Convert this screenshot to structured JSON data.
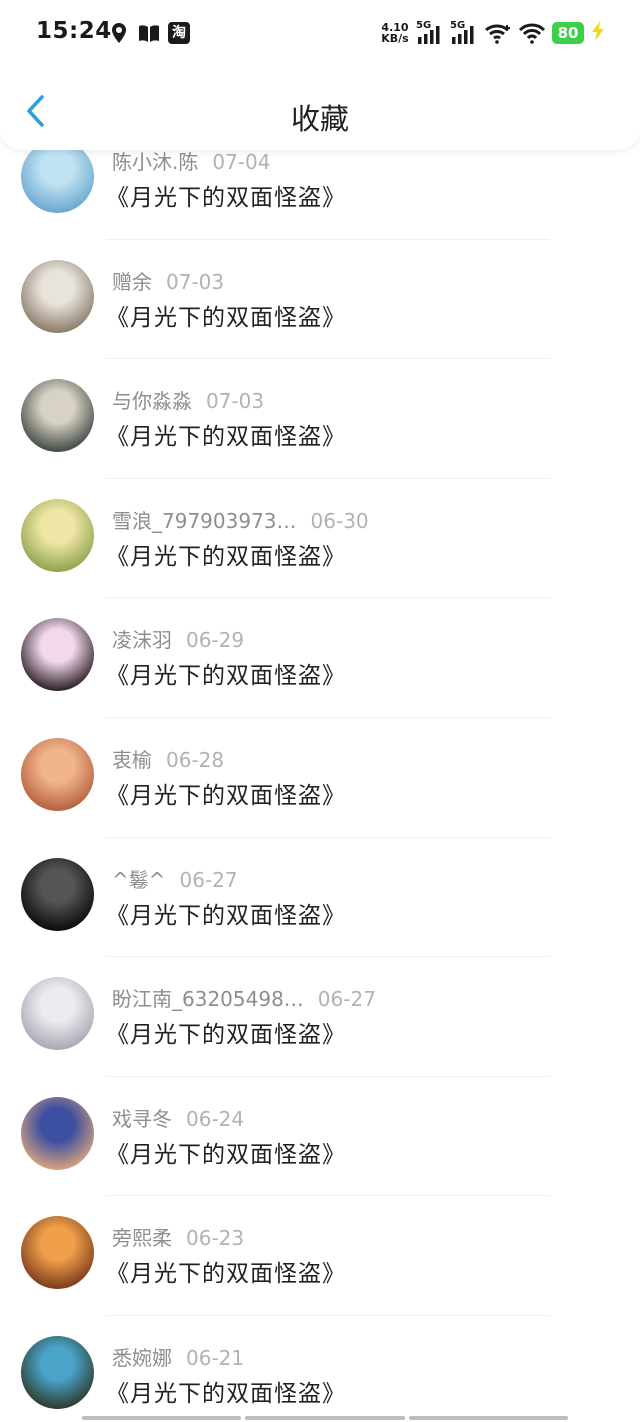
{
  "status_bar": {
    "time": "15:24",
    "net_speed_value": "4.10",
    "net_speed_unit": "KB/s",
    "sim1_label": "5G",
    "sim2_label": "5G",
    "battery": "80",
    "taobao_glyph": "淘"
  },
  "header": {
    "title": "收藏",
    "accent_color": "#2f9ee0"
  },
  "favorites": [
    {
      "user": "陈小沐.陈",
      "date": "07-04",
      "book": "《月光下的双面怪盗》",
      "avatar_colors": [
        "#bfe3f2",
        "#6aa6cf"
      ]
    },
    {
      "user": "赠余",
      "date": "07-03",
      "book": "《月光下的双面怪盗》",
      "avatar_colors": [
        "#e8e4dc",
        "#8b7a68"
      ]
    },
    {
      "user": "与你淼淼",
      "date": "07-03",
      "book": "《月光下的双面怪盗》",
      "avatar_colors": [
        "#d8d2c4",
        "#3f4a44"
      ]
    },
    {
      "user": "雪浪_797903973…",
      "date": "06-30",
      "book": "《月光下的双面怪盗》",
      "avatar_colors": [
        "#efe6a6",
        "#8fa34d"
      ]
    },
    {
      "user": "凌沫羽",
      "date": "06-29",
      "book": "《月光下的双面怪盗》",
      "avatar_colors": [
        "#f3d9ec",
        "#2a1f24"
      ]
    },
    {
      "user": "衷榆",
      "date": "06-28",
      "book": "《月光下的双面怪盗》",
      "avatar_colors": [
        "#f1b58e",
        "#b5603d"
      ]
    },
    {
      "user": "^鬈^",
      "date": "06-27",
      "book": "《月光下的双面怪盗》",
      "avatar_colors": [
        "#555555",
        "#0b0b0b"
      ]
    },
    {
      "user": "盼江南_63205498…",
      "date": "06-27",
      "book": "《月光下的双面怪盗》",
      "avatar_colors": [
        "#ececf0",
        "#a9a7b3"
      ]
    },
    {
      "user": "戏寻冬",
      "date": "06-24",
      "book": "《月光下的双面怪盗》",
      "avatar_colors": [
        "#3c4fa0",
        "#d8a37f"
      ]
    },
    {
      "user": "旁熙柔",
      "date": "06-23",
      "book": "《月光下的双面怪盗》",
      "avatar_colors": [
        "#f0a04a",
        "#7a3b1c"
      ]
    },
    {
      "user": "悉婉娜",
      "date": "06-21",
      "book": "《月光下的双面怪盗》",
      "avatar_colors": [
        "#4aa3c9",
        "#2c3a2a"
      ]
    }
  ]
}
